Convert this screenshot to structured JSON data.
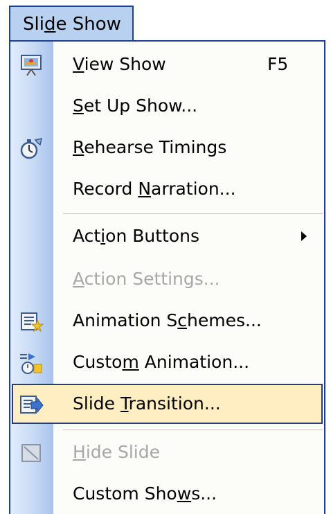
{
  "menubar": {
    "title_pre": "Sli",
    "title_ul": "d",
    "title_post": "e Show"
  },
  "menu": {
    "items": [
      {
        "pre": "",
        "ul": "V",
        "post": "iew Show",
        "shortcut": "F5",
        "icon": "projector-screen-icon"
      },
      {
        "pre": "",
        "ul": "S",
        "post": "et Up Show...",
        "shortcut": "",
        "icon": ""
      },
      {
        "pre": "",
        "ul": "R",
        "post": "ehearse Timings",
        "shortcut": "",
        "icon": "stopwatch-icon"
      },
      {
        "pre": "Record ",
        "ul": "N",
        "post": "arration...",
        "shortcut": "",
        "icon": ""
      },
      {
        "pre": "Act",
        "ul": "i",
        "post": "on Buttons",
        "shortcut": "",
        "icon": ""
      },
      {
        "pre": "",
        "ul": "A",
        "post": "ction Settings...",
        "shortcut": "",
        "icon": ""
      },
      {
        "pre": "Animation S",
        "ul": "c",
        "post": "hemes...",
        "shortcut": "",
        "icon": "animation-schemes-icon"
      },
      {
        "pre": "Custo",
        "ul": "m",
        "post": " Animation...",
        "shortcut": "",
        "icon": "custom-animation-icon"
      },
      {
        "pre": "Slide ",
        "ul": "T",
        "post": "ransition...",
        "shortcut": "",
        "icon": "slide-transition-icon"
      },
      {
        "pre": "",
        "ul": "H",
        "post": "ide Slide",
        "shortcut": "",
        "icon": "hide-slide-icon"
      },
      {
        "pre": "Custom Sho",
        "ul": "w",
        "post": "s...",
        "shortcut": "",
        "icon": ""
      }
    ]
  }
}
